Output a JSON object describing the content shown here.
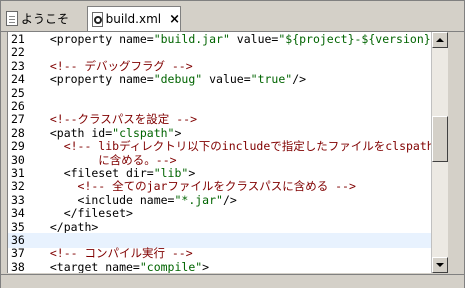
{
  "tabs": [
    {
      "label": "ようこそ",
      "icon": "document-icon"
    },
    {
      "label": "build.xml",
      "icon": "xml-file-icon",
      "active": true,
      "close_label": "×"
    }
  ],
  "editor": {
    "lines": [
      {
        "num": "21",
        "text": "  <property name=\"build.jar\" value=\"${project}-${version}.jar\"/>"
      },
      {
        "num": "22",
        "text": ""
      },
      {
        "num": "23",
        "text": "  <!-- デバッグフラグ -->"
      },
      {
        "num": "24",
        "text": "  <property name=\"debug\" value=\"true\"/>"
      },
      {
        "num": "25",
        "text": ""
      },
      {
        "num": "26",
        "text": ""
      },
      {
        "num": "27",
        "text": "  <!--クラスパスを設定 -->"
      },
      {
        "num": "28",
        "text": "  <path id=\"clspath\">"
      },
      {
        "num": "29",
        "text": "    <!-- libディレクトリ以下のincludeで指定したファイルをclspath"
      },
      {
        "num": "30",
        "text": "         に含める。-->"
      },
      {
        "num": "31",
        "text": "    <fileset dir=\"lib\">"
      },
      {
        "num": "32",
        "text": "      <!-- 全てのjarファイルをクラスパスに含める -->"
      },
      {
        "num": "33",
        "text": "      <include name=\"*.jar\"/>"
      },
      {
        "num": "34",
        "text": "    </fileset>"
      },
      {
        "num": "35",
        "text": "  </path>"
      },
      {
        "num": "36",
        "text": "",
        "highlight": true
      },
      {
        "num": "37",
        "text": "  <!-- コンパイル実行 -->"
      },
      {
        "num": "38",
        "text": "  <target name=\"compile\">"
      }
    ]
  },
  "scrollbar": {
    "position": 0.42
  },
  "colors": {
    "accent": "#000080",
    "current_line": "#e8f2fe",
    "comment": "#800000",
    "value": "#006400"
  }
}
